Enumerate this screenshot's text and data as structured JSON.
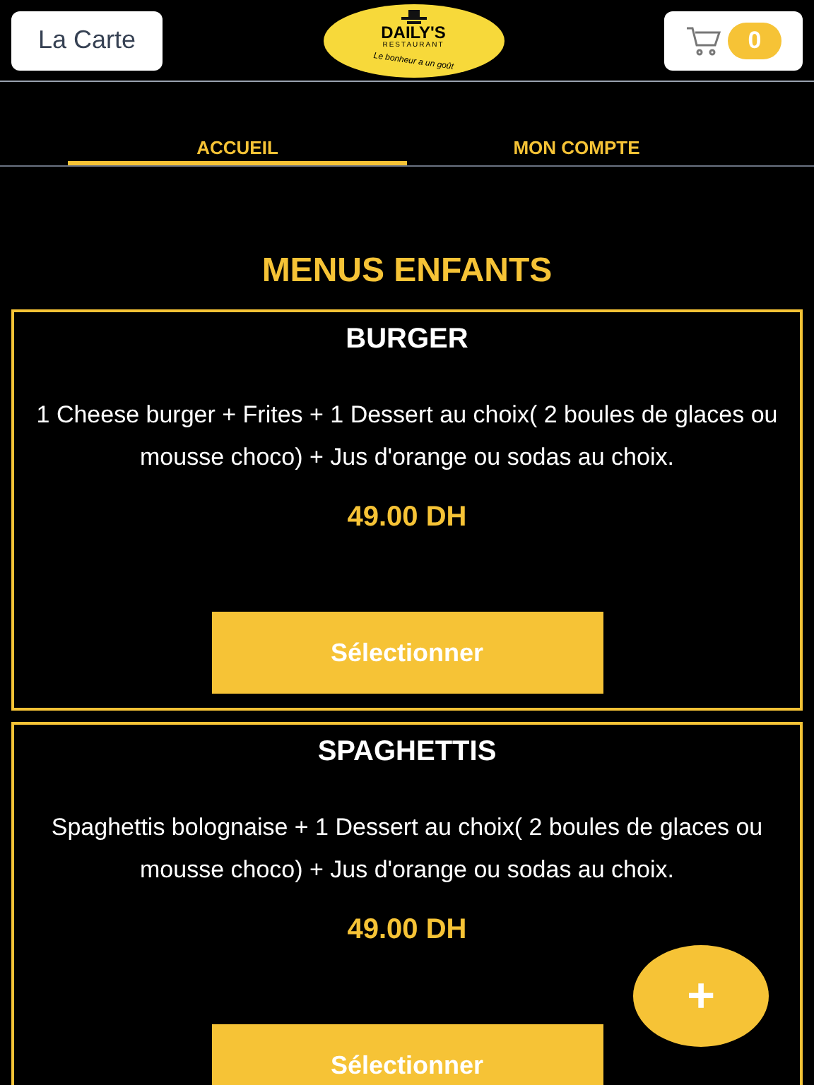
{
  "header": {
    "menu_button": "La Carte",
    "logo": {
      "name": "DAILY'S",
      "subtitle": "RESTAURANT",
      "tagline": "Le bonheur a un goût"
    },
    "cart_count": "0"
  },
  "tabs": [
    {
      "label": "ACCUEIL",
      "selected": true
    },
    {
      "label": "MON COMPTE",
      "selected": false
    }
  ],
  "section_title": "MENUS ENFANTS",
  "menus": [
    {
      "name": "BURGER",
      "description": "1 Cheese burger + Frites + 1 Dessert au choix( 2 boules de glaces ou mousse choco) + Jus d'orange ou sodas au choix.",
      "price": "49.00 DH",
      "button": "Sélectionner"
    },
    {
      "name": "SPAGHETTIS",
      "description": "Spaghettis bolognaise + 1 Dessert au choix( 2 boules de glaces ou mousse choco) + Jus d'orange ou sodas au choix.",
      "price": "49.00 DH",
      "button": "Sélectionner"
    }
  ],
  "fab": "+"
}
